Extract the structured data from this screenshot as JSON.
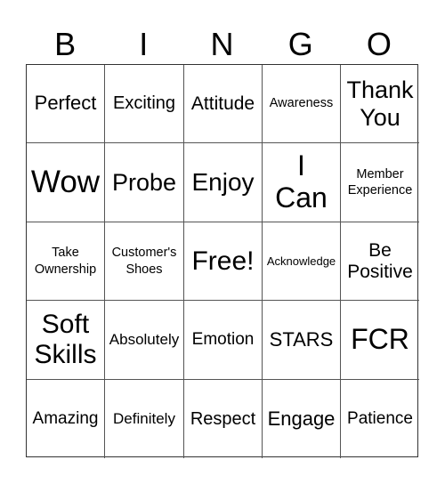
{
  "header": {
    "letters": [
      "B",
      "I",
      "N",
      "G",
      "O"
    ]
  },
  "board": {
    "cells": [
      "Perfect",
      "Exciting",
      "Attitude",
      "Awareness",
      "Thank\nYou",
      "Wow",
      "Probe",
      "Enjoy",
      "I\nCan",
      "Member\nExperience",
      "Take\nOwnership",
      "Customer's\nShoes",
      "Free!",
      "Acknowledge",
      "Be\nPositive",
      "Soft\nSkills",
      "Absolutely",
      "Emotion",
      "STARS",
      "FCR",
      "Amazing",
      "Definitely",
      "Respect",
      "Engage",
      "Patience"
    ]
  }
}
